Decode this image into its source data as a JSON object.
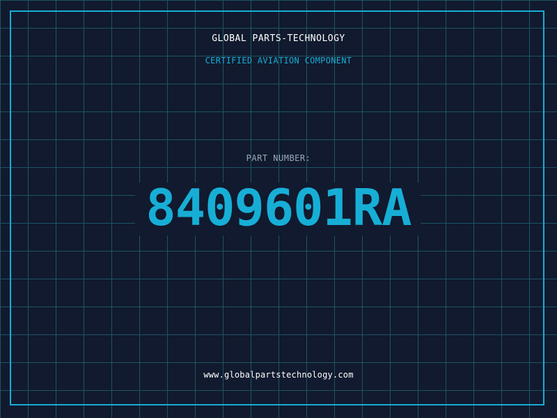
{
  "header": {
    "company": "GLOBAL PARTS-TECHNOLOGY",
    "subtitle": "CERTIFIED AVIATION COMPONENT"
  },
  "part": {
    "label": "PART NUMBER:",
    "number": "8409601RA"
  },
  "footer": {
    "url": "www.globalpartstechnology.com"
  },
  "colors": {
    "background": "#111a2e",
    "grid": "#1e5466",
    "accent": "#17aed6",
    "text": "#ffffff",
    "muted": "#9aa8bc"
  }
}
